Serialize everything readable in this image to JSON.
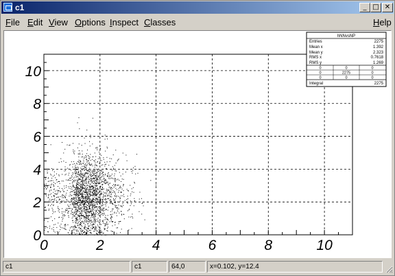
{
  "window": {
    "title": "c1"
  },
  "menu": {
    "file": {
      "label": "File",
      "key": "F",
      "rest": "ile"
    },
    "edit": {
      "label": "Edit",
      "key": "E",
      "rest": "dit"
    },
    "view": {
      "label": "View",
      "key": "V",
      "rest": "iew"
    },
    "options": {
      "label": "Options",
      "key": "O",
      "rest": "ptions"
    },
    "inspect": {
      "label": "Inspect",
      "key": "I",
      "rest": "nspect"
    },
    "classes": {
      "label": "Classes",
      "key": "C",
      "rest": "lasses"
    },
    "help": {
      "label": "Help",
      "key": "H",
      "rest": "elp"
    }
  },
  "stats": {
    "title": "hNNvsNP",
    "rows": [
      {
        "label": "Entries",
        "value": "2275"
      },
      {
        "label": "Mean x",
        "value": "1.392"
      },
      {
        "label": "Mean y",
        "value": "2.323"
      },
      {
        "label": "RMS x",
        "value": "0.7618"
      },
      {
        "label": "RMS y",
        "value": "1.269"
      }
    ],
    "grid": [
      [
        "0",
        "0",
        "0"
      ],
      [
        "0",
        "2275",
        "0"
      ],
      [
        "0",
        "0",
        "0"
      ]
    ],
    "integral_label": "Integral",
    "integral_value": "2275"
  },
  "status": {
    "object": "c1",
    "name": "c1",
    "pixel": "64,0",
    "coords": "x=0.102, y=12.4"
  },
  "chart_data": {
    "type": "scatter",
    "title": "",
    "xlabel": "",
    "ylabel": "",
    "xlim": [
      0,
      11
    ],
    "ylim": [
      0,
      11
    ],
    "x_ticks": [
      "0",
      "2",
      "4",
      "6",
      "8",
      "10"
    ],
    "y_ticks": [
      "0",
      "2",
      "4",
      "6",
      "8",
      "10"
    ],
    "grid": true,
    "legend": "none",
    "entries": 2275,
    "mean_x": 1.392,
    "mean_y": 2.323,
    "rms_x": 0.7618,
    "rms_y": 1.269,
    "marker_color": "#000000"
  }
}
